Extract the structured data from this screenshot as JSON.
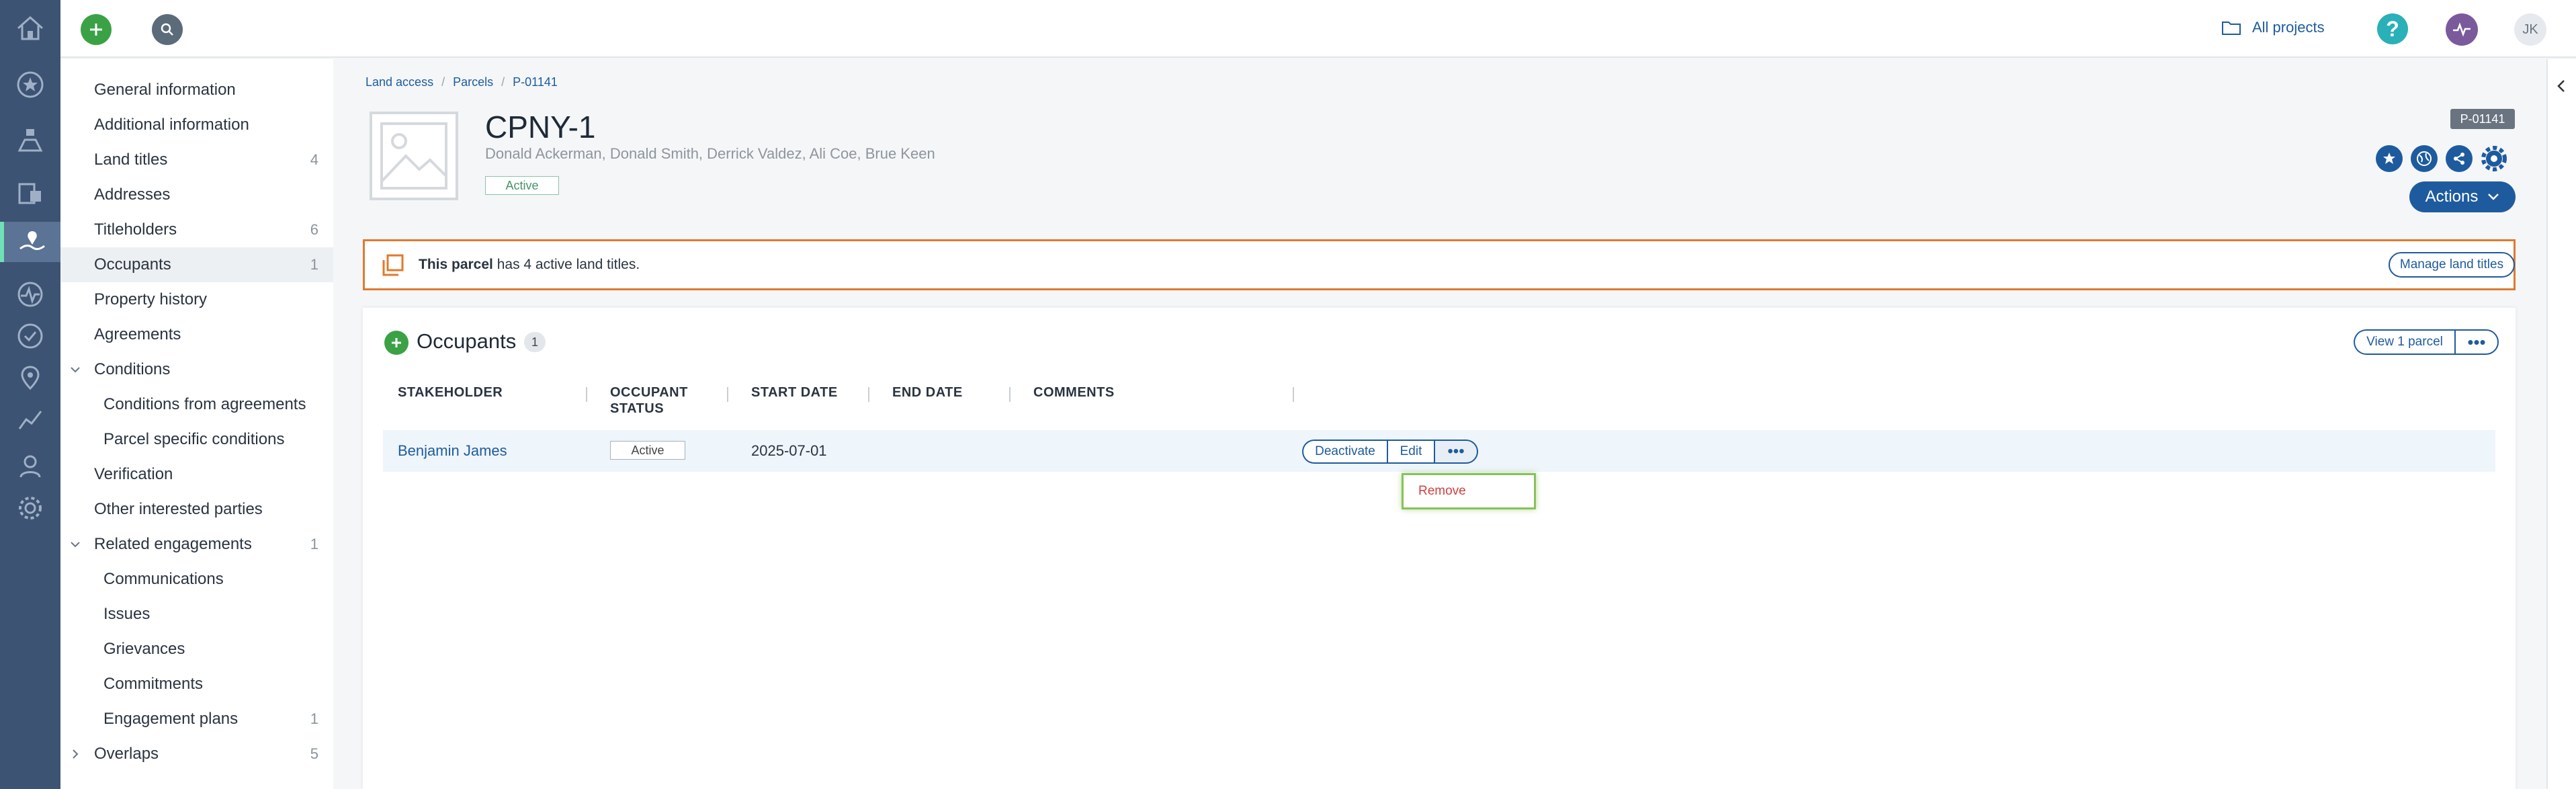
{
  "topbar": {
    "all_projects_label": "All projects",
    "help_label": "?",
    "user_initials": "JK"
  },
  "rail": {
    "icons": [
      "home-icon",
      "star-icon",
      "stakeholders-icon",
      "inbox-icon",
      "land-access-icon",
      "activity-icon",
      "check-icon",
      "location-icon",
      "chart-icon",
      "person-icon",
      "gear-icon"
    ]
  },
  "subnav": {
    "items": [
      {
        "label": "General information",
        "count": ""
      },
      {
        "label": "Additional information",
        "count": ""
      },
      {
        "label": "Land titles",
        "count": "4"
      },
      {
        "label": "Addresses",
        "count": ""
      },
      {
        "label": "Titleholders",
        "count": "6"
      },
      {
        "label": "Occupants",
        "count": "1"
      },
      {
        "label": "Property history",
        "count": ""
      },
      {
        "label": "Agreements",
        "count": ""
      },
      {
        "label": "Conditions",
        "count": ""
      },
      {
        "label": "Conditions from agreements",
        "count": ""
      },
      {
        "label": "Parcel specific conditions",
        "count": ""
      },
      {
        "label": "Verification",
        "count": ""
      },
      {
        "label": "Other interested parties",
        "count": ""
      },
      {
        "label": "Related engagements",
        "count": "1"
      },
      {
        "label": "Communications",
        "count": ""
      },
      {
        "label": "Issues",
        "count": ""
      },
      {
        "label": "Grievances",
        "count": ""
      },
      {
        "label": "Commitments",
        "count": ""
      },
      {
        "label": "Engagement plans",
        "count": "1"
      },
      {
        "label": "Overlaps",
        "count": "5"
      }
    ]
  },
  "breadcrumb": [
    "Land access",
    "Parcels",
    "P-01141"
  ],
  "header": {
    "title": "CPNY-1",
    "owners": "Donald Ackerman, Donald Smith, Derrick Valdez, Ali Coe, Brue Keen",
    "status": "Active",
    "id_badge": "P-01141",
    "actions_label": "Actions"
  },
  "notice": {
    "bold": "This parcel",
    "rest": " has 4 active land titles.",
    "button": "Manage land titles"
  },
  "occupants": {
    "title": "Occupants",
    "count": "1",
    "view_button": "View 1 parcel",
    "more_label": "•••",
    "columns": [
      "STAKEHOLDER",
      "OCCUPANT STATUS",
      "START DATE",
      "END DATE",
      "COMMENTS"
    ],
    "rows": [
      {
        "stakeholder": "Benjamin James",
        "status": "Active",
        "start": "2025-07-01",
        "end": "",
        "comments": ""
      }
    ],
    "row_actions": {
      "deactivate": "Deactivate",
      "edit": "Edit",
      "more": "•••"
    },
    "dropdown": {
      "remove": "Remove"
    }
  },
  "colors": {
    "rail": "#3c5373",
    "accent": "#1e5b9e",
    "green": "#3aa245",
    "warning_border": "#e07a2e",
    "highlight": "#86c25a"
  }
}
